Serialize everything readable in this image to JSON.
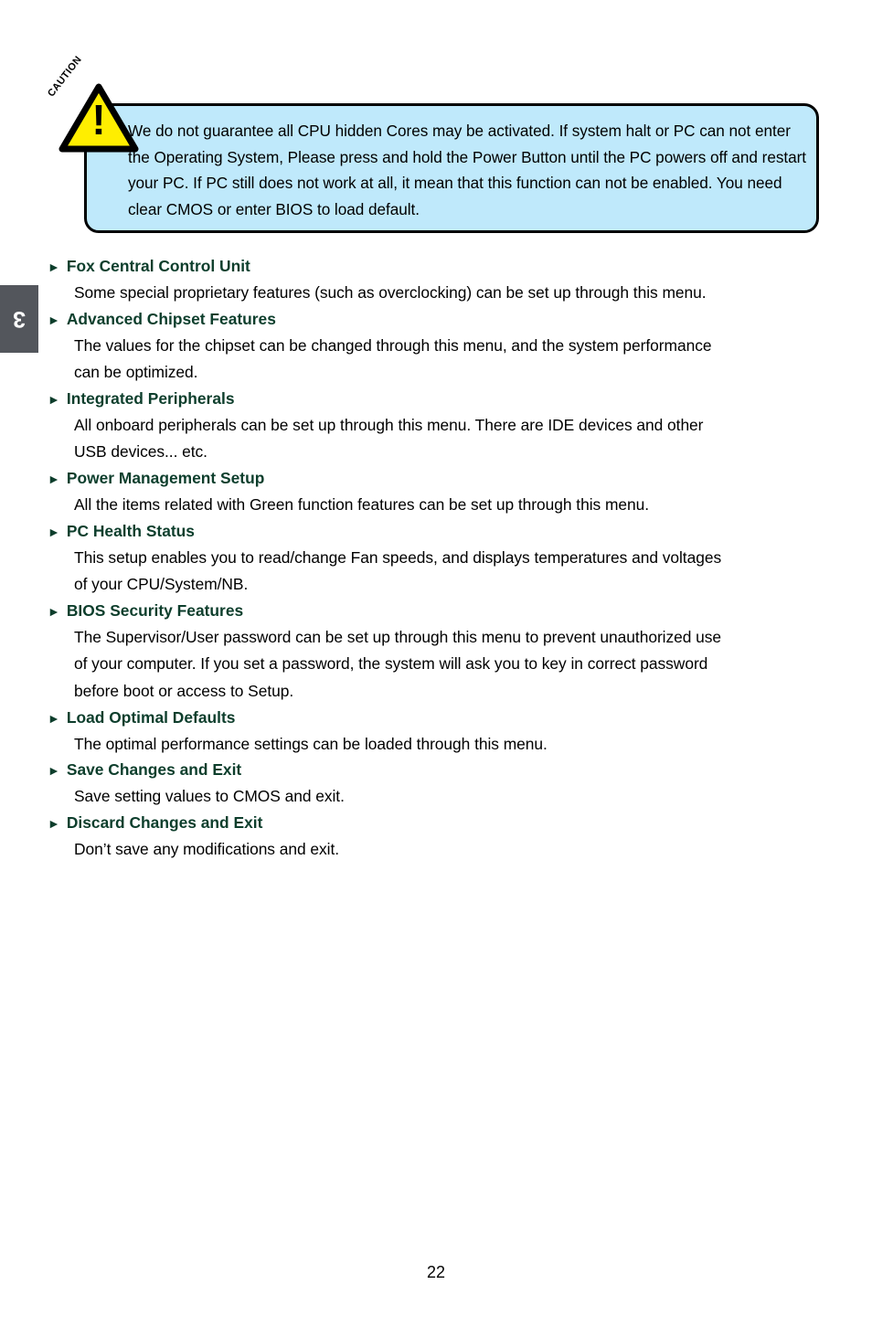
{
  "chapter_tab": {
    "number": "3"
  },
  "caution": {
    "sign_label": "CAUTION",
    "exclamation": "!",
    "text": "We do not guarantee all CPU hidden Cores may be activated. If system halt or PC can not enter the Operating System, Please press and hold the Power Button until the PC powers off and restart your PC. If PC still does not work at all, it mean that this function can not be enabled. You need clear CMOS or enter BIOS to load default."
  },
  "bullet_glyph": "►",
  "entries": [
    {
      "title": "Fox Central Control Unit",
      "lines": [
        "Some special proprietary features (such as overclocking) can be set up through this menu."
      ]
    },
    {
      "title": "Advanced Chipset Features",
      "lines": [
        "The values for the chipset can be changed through this menu, and the system performance",
        "can be optimized."
      ]
    },
    {
      "title": "Integrated Peripherals",
      "lines": [
        "All onboard peripherals can be set up through this menu. There are IDE devices and other",
        "USB devices... etc."
      ]
    },
    {
      "title": "Power Management Setup",
      "lines": [
        "All the items related with Green function features can be set up through this menu."
      ]
    },
    {
      "title": "PC Health Status",
      "lines": [
        "This setup enables you to read/change Fan speeds, and displays temperatures and voltages",
        "of your CPU/System/NB."
      ]
    },
    {
      "title": "BIOS Security Features",
      "lines": [
        "The Supervisor/User password can be set up through this menu to prevent unauthorized use",
        "of your computer. If you set a password, the system will ask you to key in correct password",
        "before boot or access to Setup."
      ]
    },
    {
      "title": "Load Optimal Defaults",
      "lines": [
        "The optimal performance settings can be loaded through this menu."
      ]
    },
    {
      "title": "Save Changes and Exit",
      "lines": [
        "Save setting values to CMOS and exit."
      ]
    },
    {
      "title": "Discard Changes and Exit",
      "lines": [
        "Don’t save any modifications and exit."
      ]
    }
  ],
  "page_number": "22",
  "colors": {
    "heading_green": "#0d3e2c",
    "caution_fill": "#bfe9fb",
    "caution_border": "#000000",
    "sign_yellow": "#ffee00",
    "tab_gray": "#53565c"
  }
}
